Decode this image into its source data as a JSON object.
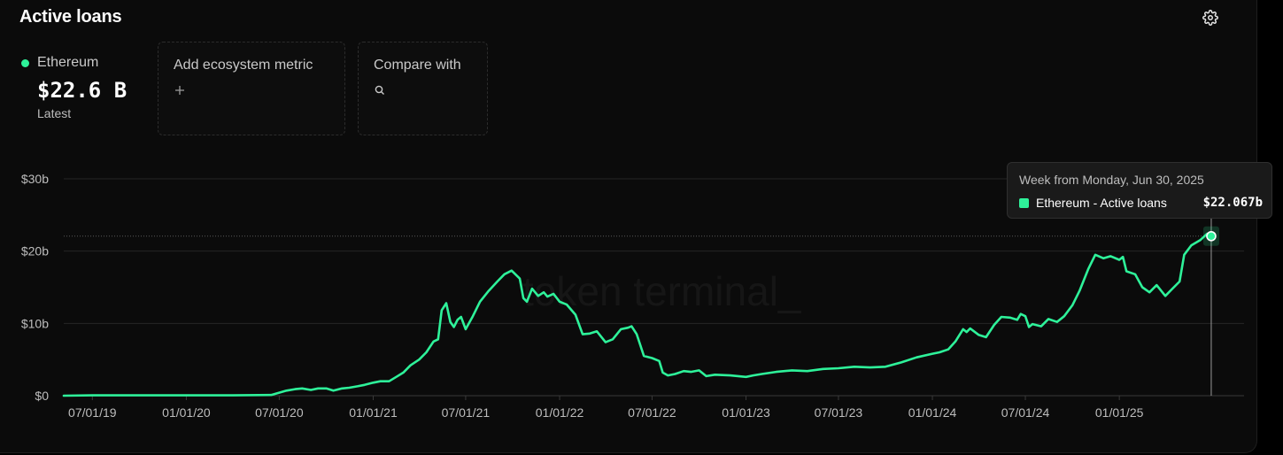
{
  "header": {
    "title": "Active loans"
  },
  "series_summary": {
    "name": "Ethereum",
    "value": "$22.6 B",
    "sub": "Latest"
  },
  "cards": {
    "ecosystem": {
      "label": "Add ecosystem metric",
      "icon": "plus-icon"
    },
    "compare": {
      "label": "Compare with",
      "icon": "search-icon"
    }
  },
  "watermark": "token terminal_",
  "tooltip": {
    "title": "Week from Monday, Jun 30, 2025",
    "series_label": "Ethereum - Active loans",
    "value": "$22.067b"
  },
  "colors": {
    "accent": "#2ef29a",
    "background": "#0b0b0b",
    "grid": "#262626"
  },
  "chart_data": {
    "type": "line",
    "title": "Active loans",
    "series": [
      {
        "name": "Ethereum",
        "points": [
          [
            "2019-05-06",
            0.0
          ],
          [
            "2019-07-01",
            0.05
          ],
          [
            "2019-10-01",
            0.05
          ],
          [
            "2020-01-01",
            0.05
          ],
          [
            "2020-04-01",
            0.05
          ],
          [
            "2020-06-15",
            0.1
          ],
          [
            "2020-07-15",
            0.7
          ],
          [
            "2020-08-01",
            0.9
          ],
          [
            "2020-08-15",
            1.0
          ],
          [
            "2020-09-01",
            0.8
          ],
          [
            "2020-09-15",
            1.0
          ],
          [
            "2020-10-01",
            1.0
          ],
          [
            "2020-10-15",
            0.7
          ],
          [
            "2020-11-01",
            1.0
          ],
          [
            "2020-11-15",
            1.1
          ],
          [
            "2020-12-01",
            1.3
          ],
          [
            "2020-12-15",
            1.5
          ],
          [
            "2021-01-01",
            1.8
          ],
          [
            "2021-01-15",
            2.0
          ],
          [
            "2021-02-01",
            2.0
          ],
          [
            "2021-02-15",
            2.6
          ],
          [
            "2021-03-01",
            3.2
          ],
          [
            "2021-03-15",
            4.2
          ],
          [
            "2021-04-01",
            5.0
          ],
          [
            "2021-04-15",
            6.0
          ],
          [
            "2021-04-29",
            7.5
          ],
          [
            "2021-05-08",
            7.8
          ],
          [
            "2021-05-15",
            11.8
          ],
          [
            "2021-05-24",
            12.8
          ],
          [
            "2021-06-01",
            10.2
          ],
          [
            "2021-06-08",
            9.5
          ],
          [
            "2021-06-15",
            10.5
          ],
          [
            "2021-06-22",
            10.9
          ],
          [
            "2021-07-01",
            9.2
          ],
          [
            "2021-07-15",
            11.0
          ],
          [
            "2021-07-29",
            13.0
          ],
          [
            "2021-08-15",
            14.5
          ],
          [
            "2021-09-01",
            15.8
          ],
          [
            "2021-09-15",
            16.8
          ],
          [
            "2021-09-29",
            17.3
          ],
          [
            "2021-10-15",
            16.2
          ],
          [
            "2021-10-22",
            13.5
          ],
          [
            "2021-10-29",
            13.0
          ],
          [
            "2021-11-08",
            14.8
          ],
          [
            "2021-11-20",
            13.8
          ],
          [
            "2021-12-01",
            14.3
          ],
          [
            "2021-12-08",
            13.7
          ],
          [
            "2021-12-20",
            14.1
          ],
          [
            "2022-01-01",
            13.0
          ],
          [
            "2022-01-15",
            12.6
          ],
          [
            "2022-02-01",
            11.2
          ],
          [
            "2022-02-15",
            8.5
          ],
          [
            "2022-03-01",
            8.6
          ],
          [
            "2022-03-15",
            8.9
          ],
          [
            "2022-04-01",
            7.4
          ],
          [
            "2022-04-15",
            7.8
          ],
          [
            "2022-05-01",
            9.2
          ],
          [
            "2022-05-15",
            9.4
          ],
          [
            "2022-05-22",
            9.6
          ],
          [
            "2022-06-01",
            8.5
          ],
          [
            "2022-06-15",
            5.5
          ],
          [
            "2022-07-01",
            5.2
          ],
          [
            "2022-07-15",
            4.8
          ],
          [
            "2022-07-22",
            3.2
          ],
          [
            "2022-08-01",
            2.8
          ],
          [
            "2022-08-15",
            3.0
          ],
          [
            "2022-09-01",
            3.4
          ],
          [
            "2022-09-15",
            3.3
          ],
          [
            "2022-10-01",
            3.5
          ],
          [
            "2022-10-15",
            2.7
          ],
          [
            "2022-11-01",
            2.9
          ],
          [
            "2022-12-01",
            2.8
          ],
          [
            "2023-01-01",
            2.6
          ],
          [
            "2023-01-15",
            2.8
          ],
          [
            "2023-02-01",
            3.0
          ],
          [
            "2023-03-01",
            3.3
          ],
          [
            "2023-04-01",
            3.5
          ],
          [
            "2023-05-01",
            3.4
          ],
          [
            "2023-06-01",
            3.7
          ],
          [
            "2023-07-01",
            3.8
          ],
          [
            "2023-08-01",
            4.0
          ],
          [
            "2023-09-01",
            3.9
          ],
          [
            "2023-10-01",
            4.0
          ],
          [
            "2023-11-01",
            4.6
          ],
          [
            "2023-12-01",
            5.3
          ],
          [
            "2024-01-01",
            5.8
          ],
          [
            "2024-01-15",
            6.0
          ],
          [
            "2024-02-01",
            6.4
          ],
          [
            "2024-02-15",
            7.5
          ],
          [
            "2024-03-01",
            9.2
          ],
          [
            "2024-03-08",
            8.8
          ],
          [
            "2024-03-15",
            9.3
          ],
          [
            "2024-04-01",
            8.4
          ],
          [
            "2024-04-15",
            8.1
          ],
          [
            "2024-05-01",
            9.8
          ],
          [
            "2024-05-15",
            10.9
          ],
          [
            "2024-06-01",
            10.8
          ],
          [
            "2024-06-15",
            10.5
          ],
          [
            "2024-06-22",
            11.3
          ],
          [
            "2024-07-01",
            11.0
          ],
          [
            "2024-07-08",
            9.5
          ],
          [
            "2024-07-15",
            9.9
          ],
          [
            "2024-08-01",
            9.6
          ],
          [
            "2024-08-15",
            10.6
          ],
          [
            "2024-09-01",
            10.2
          ],
          [
            "2024-09-15",
            11.0
          ],
          [
            "2024-10-01",
            12.5
          ],
          [
            "2024-10-15",
            14.5
          ],
          [
            "2024-11-01",
            17.5
          ],
          [
            "2024-11-15",
            19.5
          ],
          [
            "2024-12-01",
            19.0
          ],
          [
            "2024-12-15",
            19.3
          ],
          [
            "2025-01-01",
            18.8
          ],
          [
            "2025-01-08",
            19.2
          ],
          [
            "2025-01-15",
            17.2
          ],
          [
            "2025-02-01",
            16.8
          ],
          [
            "2025-02-15",
            15.0
          ],
          [
            "2025-03-01",
            14.3
          ],
          [
            "2025-03-15",
            15.3
          ],
          [
            "2025-04-01",
            13.8
          ],
          [
            "2025-04-15",
            14.8
          ],
          [
            "2025-04-29",
            15.8
          ],
          [
            "2025-05-08",
            19.5
          ],
          [
            "2025-05-22",
            20.8
          ],
          [
            "2025-06-08",
            21.5
          ],
          [
            "2025-06-22",
            22.4
          ],
          [
            "2025-06-30",
            22.067
          ]
        ]
      }
    ],
    "x_range": [
      "2019-05-06",
      "2025-07-07"
    ],
    "x_ticks": [
      "07/01/19",
      "01/01/20",
      "07/01/20",
      "01/01/21",
      "07/01/21",
      "01/01/22",
      "07/01/22",
      "01/01/23",
      "07/01/23",
      "01/01/24",
      "07/01/24",
      "01/01/25"
    ],
    "x_tick_dates": [
      "2019-07-01",
      "2020-01-01",
      "2020-07-01",
      "2021-01-01",
      "2021-07-01",
      "2022-01-01",
      "2022-07-01",
      "2023-01-01",
      "2023-07-01",
      "2024-01-01",
      "2024-07-01",
      "2025-01-01"
    ],
    "y_ticks": [
      {
        "value": 0,
        "label": "$0"
      },
      {
        "value": 10,
        "label": "$10b"
      },
      {
        "value": 20,
        "label": "$20b"
      },
      {
        "value": 30,
        "label": "$30b"
      }
    ],
    "ylim": [
      0,
      30
    ],
    "hover": {
      "date": "2025-06-30",
      "value": 22.067
    },
    "grid": true
  }
}
